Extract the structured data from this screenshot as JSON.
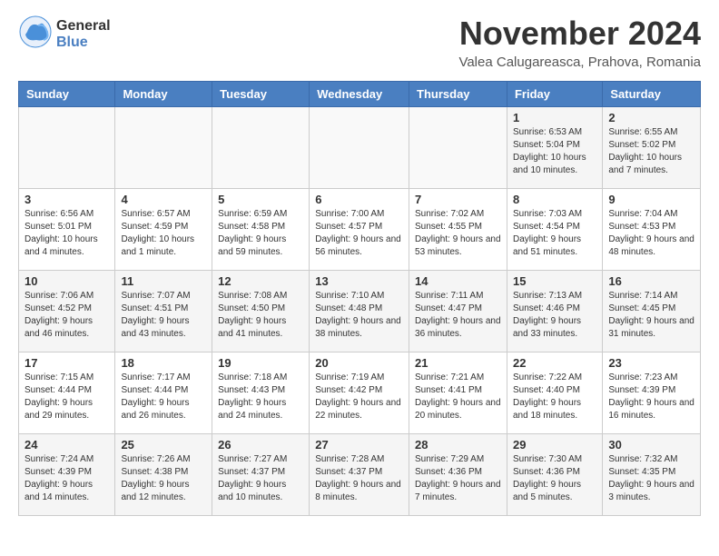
{
  "header": {
    "logo_general": "General",
    "logo_blue": "Blue",
    "month_title": "November 2024",
    "location": "Valea Calugareasca, Prahova, Romania"
  },
  "columns": [
    "Sunday",
    "Monday",
    "Tuesday",
    "Wednesday",
    "Thursday",
    "Friday",
    "Saturday"
  ],
  "weeks": [
    [
      {
        "day": "",
        "info": ""
      },
      {
        "day": "",
        "info": ""
      },
      {
        "day": "",
        "info": ""
      },
      {
        "day": "",
        "info": ""
      },
      {
        "day": "",
        "info": ""
      },
      {
        "day": "1",
        "info": "Sunrise: 6:53 AM\nSunset: 5:04 PM\nDaylight: 10 hours and 10 minutes."
      },
      {
        "day": "2",
        "info": "Sunrise: 6:55 AM\nSunset: 5:02 PM\nDaylight: 10 hours and 7 minutes."
      }
    ],
    [
      {
        "day": "3",
        "info": "Sunrise: 6:56 AM\nSunset: 5:01 PM\nDaylight: 10 hours and 4 minutes."
      },
      {
        "day": "4",
        "info": "Sunrise: 6:57 AM\nSunset: 4:59 PM\nDaylight: 10 hours and 1 minute."
      },
      {
        "day": "5",
        "info": "Sunrise: 6:59 AM\nSunset: 4:58 PM\nDaylight: 9 hours and 59 minutes."
      },
      {
        "day": "6",
        "info": "Sunrise: 7:00 AM\nSunset: 4:57 PM\nDaylight: 9 hours and 56 minutes."
      },
      {
        "day": "7",
        "info": "Sunrise: 7:02 AM\nSunset: 4:55 PM\nDaylight: 9 hours and 53 minutes."
      },
      {
        "day": "8",
        "info": "Sunrise: 7:03 AM\nSunset: 4:54 PM\nDaylight: 9 hours and 51 minutes."
      },
      {
        "day": "9",
        "info": "Sunrise: 7:04 AM\nSunset: 4:53 PM\nDaylight: 9 hours and 48 minutes."
      }
    ],
    [
      {
        "day": "10",
        "info": "Sunrise: 7:06 AM\nSunset: 4:52 PM\nDaylight: 9 hours and 46 minutes."
      },
      {
        "day": "11",
        "info": "Sunrise: 7:07 AM\nSunset: 4:51 PM\nDaylight: 9 hours and 43 minutes."
      },
      {
        "day": "12",
        "info": "Sunrise: 7:08 AM\nSunset: 4:50 PM\nDaylight: 9 hours and 41 minutes."
      },
      {
        "day": "13",
        "info": "Sunrise: 7:10 AM\nSunset: 4:48 PM\nDaylight: 9 hours and 38 minutes."
      },
      {
        "day": "14",
        "info": "Sunrise: 7:11 AM\nSunset: 4:47 PM\nDaylight: 9 hours and 36 minutes."
      },
      {
        "day": "15",
        "info": "Sunrise: 7:13 AM\nSunset: 4:46 PM\nDaylight: 9 hours and 33 minutes."
      },
      {
        "day": "16",
        "info": "Sunrise: 7:14 AM\nSunset: 4:45 PM\nDaylight: 9 hours and 31 minutes."
      }
    ],
    [
      {
        "day": "17",
        "info": "Sunrise: 7:15 AM\nSunset: 4:44 PM\nDaylight: 9 hours and 29 minutes."
      },
      {
        "day": "18",
        "info": "Sunrise: 7:17 AM\nSunset: 4:44 PM\nDaylight: 9 hours and 26 minutes."
      },
      {
        "day": "19",
        "info": "Sunrise: 7:18 AM\nSunset: 4:43 PM\nDaylight: 9 hours and 24 minutes."
      },
      {
        "day": "20",
        "info": "Sunrise: 7:19 AM\nSunset: 4:42 PM\nDaylight: 9 hours and 22 minutes."
      },
      {
        "day": "21",
        "info": "Sunrise: 7:21 AM\nSunset: 4:41 PM\nDaylight: 9 hours and 20 minutes."
      },
      {
        "day": "22",
        "info": "Sunrise: 7:22 AM\nSunset: 4:40 PM\nDaylight: 9 hours and 18 minutes."
      },
      {
        "day": "23",
        "info": "Sunrise: 7:23 AM\nSunset: 4:39 PM\nDaylight: 9 hours and 16 minutes."
      }
    ],
    [
      {
        "day": "24",
        "info": "Sunrise: 7:24 AM\nSunset: 4:39 PM\nDaylight: 9 hours and 14 minutes."
      },
      {
        "day": "25",
        "info": "Sunrise: 7:26 AM\nSunset: 4:38 PM\nDaylight: 9 hours and 12 minutes."
      },
      {
        "day": "26",
        "info": "Sunrise: 7:27 AM\nSunset: 4:37 PM\nDaylight: 9 hours and 10 minutes."
      },
      {
        "day": "27",
        "info": "Sunrise: 7:28 AM\nSunset: 4:37 PM\nDaylight: 9 hours and 8 minutes."
      },
      {
        "day": "28",
        "info": "Sunrise: 7:29 AM\nSunset: 4:36 PM\nDaylight: 9 hours and 7 minutes."
      },
      {
        "day": "29",
        "info": "Sunrise: 7:30 AM\nSunset: 4:36 PM\nDaylight: 9 hours and 5 minutes."
      },
      {
        "day": "30",
        "info": "Sunrise: 7:32 AM\nSunset: 4:35 PM\nDaylight: 9 hours and 3 minutes."
      }
    ]
  ]
}
